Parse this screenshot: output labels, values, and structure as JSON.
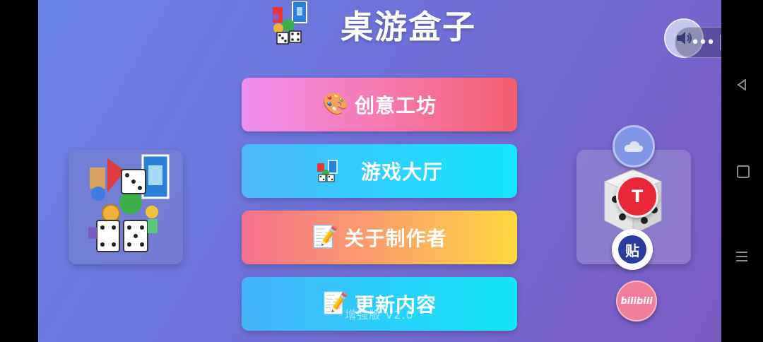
{
  "header": {
    "title": "桌游盒子",
    "logo_icon": "card-dice-logo-icon"
  },
  "capsule": {
    "more_label": "•••",
    "close_icon": "target-close-icon"
  },
  "speaker_icon": "speaker-icon",
  "menu": [
    {
      "icon": "palette-icon",
      "emoji": "🎨",
      "label": "创意工坊"
    },
    {
      "icon": "card-dice-icon",
      "emoji": "",
      "label": "游戏大厅"
    },
    {
      "icon": "memo-icon",
      "emoji": "📝",
      "label": "关于制作者"
    },
    {
      "icon": "memo-icon",
      "emoji": "📝",
      "label": "更新内容"
    }
  ],
  "version": "增强版 V2.0",
  "left_panel": {
    "icon": "board-games-collage-icon"
  },
  "right_panel": {
    "icon": "dice-icon"
  },
  "floating": {
    "cloud_icon": "cloud-icon",
    "t_label": "T",
    "tie_label": "贴",
    "bili_label": "bilibili"
  },
  "colors": {
    "bg_start": "#6a83e8",
    "bg_end": "#7b5ac2",
    "btn1": "#f77ab0",
    "btn2": "#2ed0ff",
    "btn3": "#fba069",
    "btn4": "#28d0fb"
  }
}
